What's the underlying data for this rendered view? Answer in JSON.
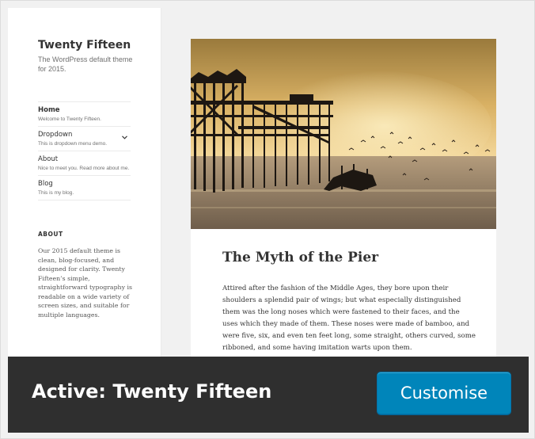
{
  "site": {
    "title": "Twenty Fifteen",
    "description": "The WordPress default theme for 2015."
  },
  "nav": {
    "items": [
      {
        "label": "Home",
        "sub": "Welcome to Twenty Fifteen.",
        "current": true
      },
      {
        "label": "Dropdown",
        "sub": "This is dropdown menu demo.",
        "has_children": true
      },
      {
        "label": "About",
        "sub": "Nice to meet you. Read more about me."
      },
      {
        "label": "Blog",
        "sub": "This is my blog."
      }
    ]
  },
  "widget": {
    "title": "ABOUT",
    "text": "Our 2015 default theme is clean, blog-focused, and designed for clarity. Twenty Fifteen’s simple, straightforward typography is readable on a wide variety of screen sizes, and suitable for multiple languages."
  },
  "post": {
    "title": "The Myth of the Pier",
    "body": "Attired after the fashion of the Middle Ages, they bore upon their shoulders a splendid pair of wings; but what especially distinguished them was the long noses which were fastened to their faces, and the uses which they made of them. These noses were made of bamboo, and were five, six, and even ten feet long, some straight, others curved, some ribboned, and some having imitation warts upon them."
  },
  "footer": {
    "active_prefix": "Active:",
    "theme_name": "Twenty Fifteen",
    "customise_label": "Customise"
  },
  "colors": {
    "accent": "#0085ba",
    "footer_bg": "#2f2f2f"
  }
}
